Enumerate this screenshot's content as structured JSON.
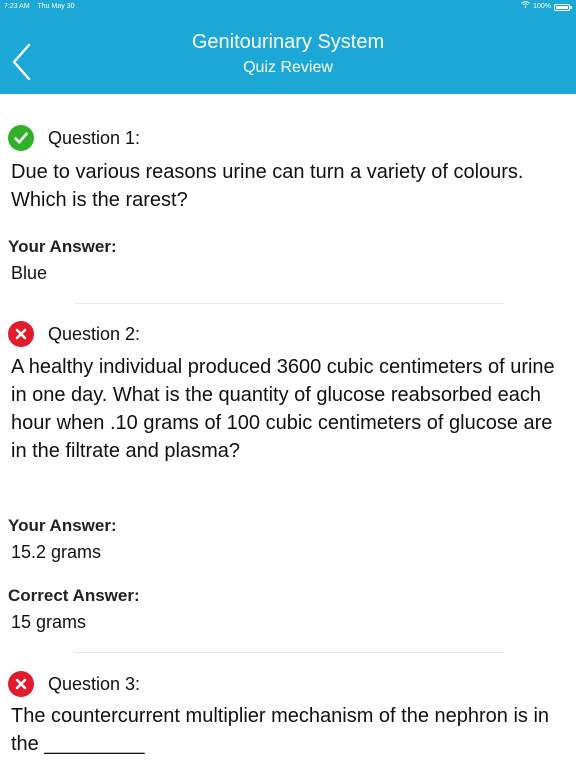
{
  "status_bar": {
    "time": "7:23 AM",
    "date": "Thu May 30",
    "battery": "100%",
    "wifi_icon": "wifi-icon",
    "battery_icon": "battery-icon"
  },
  "nav": {
    "title": "Genitourinary System",
    "subtitle": "Quiz Review",
    "back_icon": "chevron-left-icon"
  },
  "colors": {
    "header": "#1ba8d6",
    "correct": "#2fb12a",
    "wrong": "#e21b2c"
  },
  "questions": [
    {
      "label": "Question 1:",
      "status": "correct",
      "text": "Due to various reasons urine can turn a variety of colours. Which is the rarest?",
      "your_answer_label": "Your Answer:",
      "your_answer": "Blue"
    },
    {
      "label": "Question 2:",
      "status": "wrong",
      "text": "A healthy individual produced 3600 cubic centimeters of urine in one day. What is the quantity of glucose reabsorbed each hour when .10 grams of 100 cubic centimeters of glucose are in the filtrate and plasma?",
      "your_answer_label": "Your Answer:",
      "your_answer": "15.2 grams",
      "correct_answer_label": "Correct Answer:",
      "correct_answer": "15 grams"
    },
    {
      "label": "Question 3:",
      "status": "wrong",
      "text": "The countercurrent multiplier mechanism of the nephron is in the _________"
    }
  ]
}
